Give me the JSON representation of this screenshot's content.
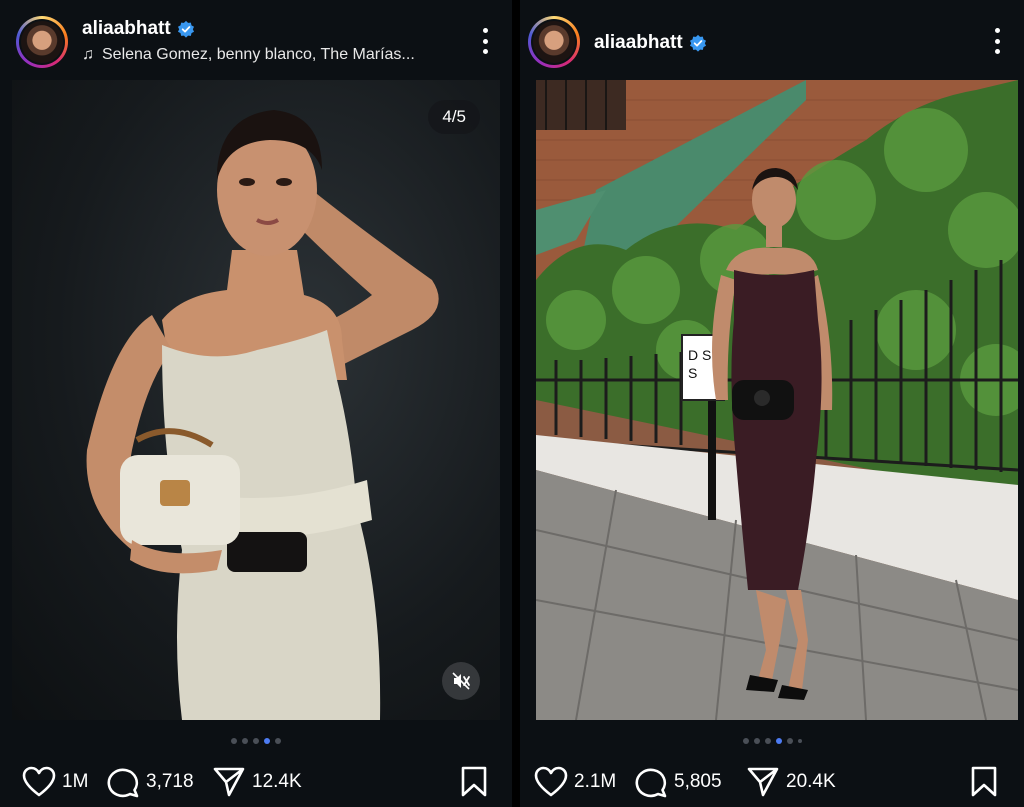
{
  "posts": [
    {
      "username": "aliaabhatt",
      "audio": "Selena Gomez, benny blanco, The Marías...",
      "counter": "4/5",
      "carousel": {
        "total": 5,
        "active": 3
      },
      "likes": "1M",
      "comments": "3,718",
      "shares": "12.4K"
    },
    {
      "username": "aliaabhatt",
      "carousel": {
        "total": 6,
        "active": 3
      },
      "likes": "2.1M",
      "comments": "5,805",
      "shares": "20.4K",
      "sign_text_1": "D S",
      "sign_text_2": "S"
    }
  ],
  "colors": {
    "accent": "#4d7cf3",
    "verified": "#3897f0",
    "background": "#0c1014"
  }
}
